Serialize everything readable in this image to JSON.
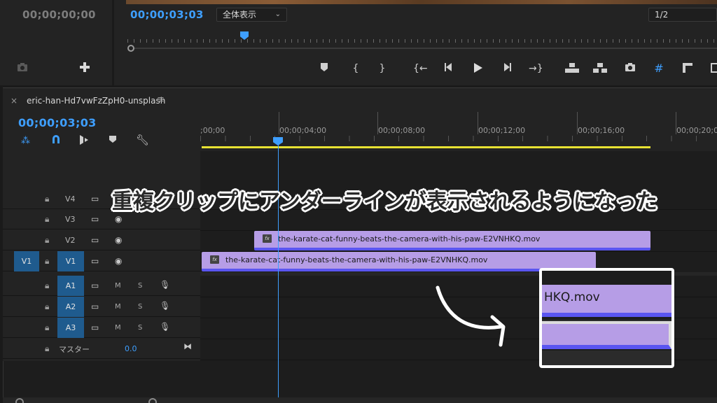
{
  "source_monitor": {
    "timecode": "00;00;00;00"
  },
  "program_monitor": {
    "timecode": "00;00;03;03",
    "fit_dropdown": "全体表示",
    "resolution_dropdown": "1/2"
  },
  "timeline": {
    "sequence_name": "eric-han-Hd7vwFzZpH0-unsplash",
    "timecode": "00;00;03;03",
    "ruler_labels": [
      ";00;00",
      "00;00;04;00",
      "00;00;08;00",
      "00;00;12;00",
      "00;00;16;00",
      "00;00;20;0"
    ],
    "tracks": {
      "v4": "V4",
      "v3": "V3",
      "v2": "V2",
      "v1": "V1",
      "v1_source": "V1",
      "a1": "A1",
      "a2": "A2",
      "a3": "A3",
      "mute": "M",
      "solo": "S",
      "master": "マスター",
      "master_value": "0.0"
    },
    "clips": {
      "v2_name": "the-karate-cat-funny-beats-the-camera-with-his-paw-E2VNHKQ.mov",
      "v1_name": "the-karate-cat-funny-beats-the-camera-with-his-paw-E2VNHKQ.mov",
      "fx_badge": "fx"
    }
  },
  "annotation": {
    "caption": "重複クリップにアンダーラインが表示されるようになった",
    "zoom_clip_text": "HKQ.mov"
  },
  "colors": {
    "accent_blue": "#3e9fff",
    "clip_purple": "#b69de6",
    "underline_blue": "#5a55f0",
    "work_area_yellow": "#e8e233",
    "track_tag_blue": "#1f5b8e"
  },
  "icons": {
    "camera": "camera-icon",
    "add": "plus-icon",
    "marker": "marker-icon",
    "in": "mark-in-icon",
    "out": "mark-out-icon",
    "goto_in": "go-to-in-icon",
    "step_back": "step-back-icon",
    "play": "play-icon",
    "step_forward": "step-forward-icon",
    "goto_out": "go-to-out-icon",
    "lift": "lift-icon",
    "extract": "extract-icon",
    "export_frame": "export-frame-icon",
    "guides": "guides-icon",
    "settings": "settings-icon"
  }
}
